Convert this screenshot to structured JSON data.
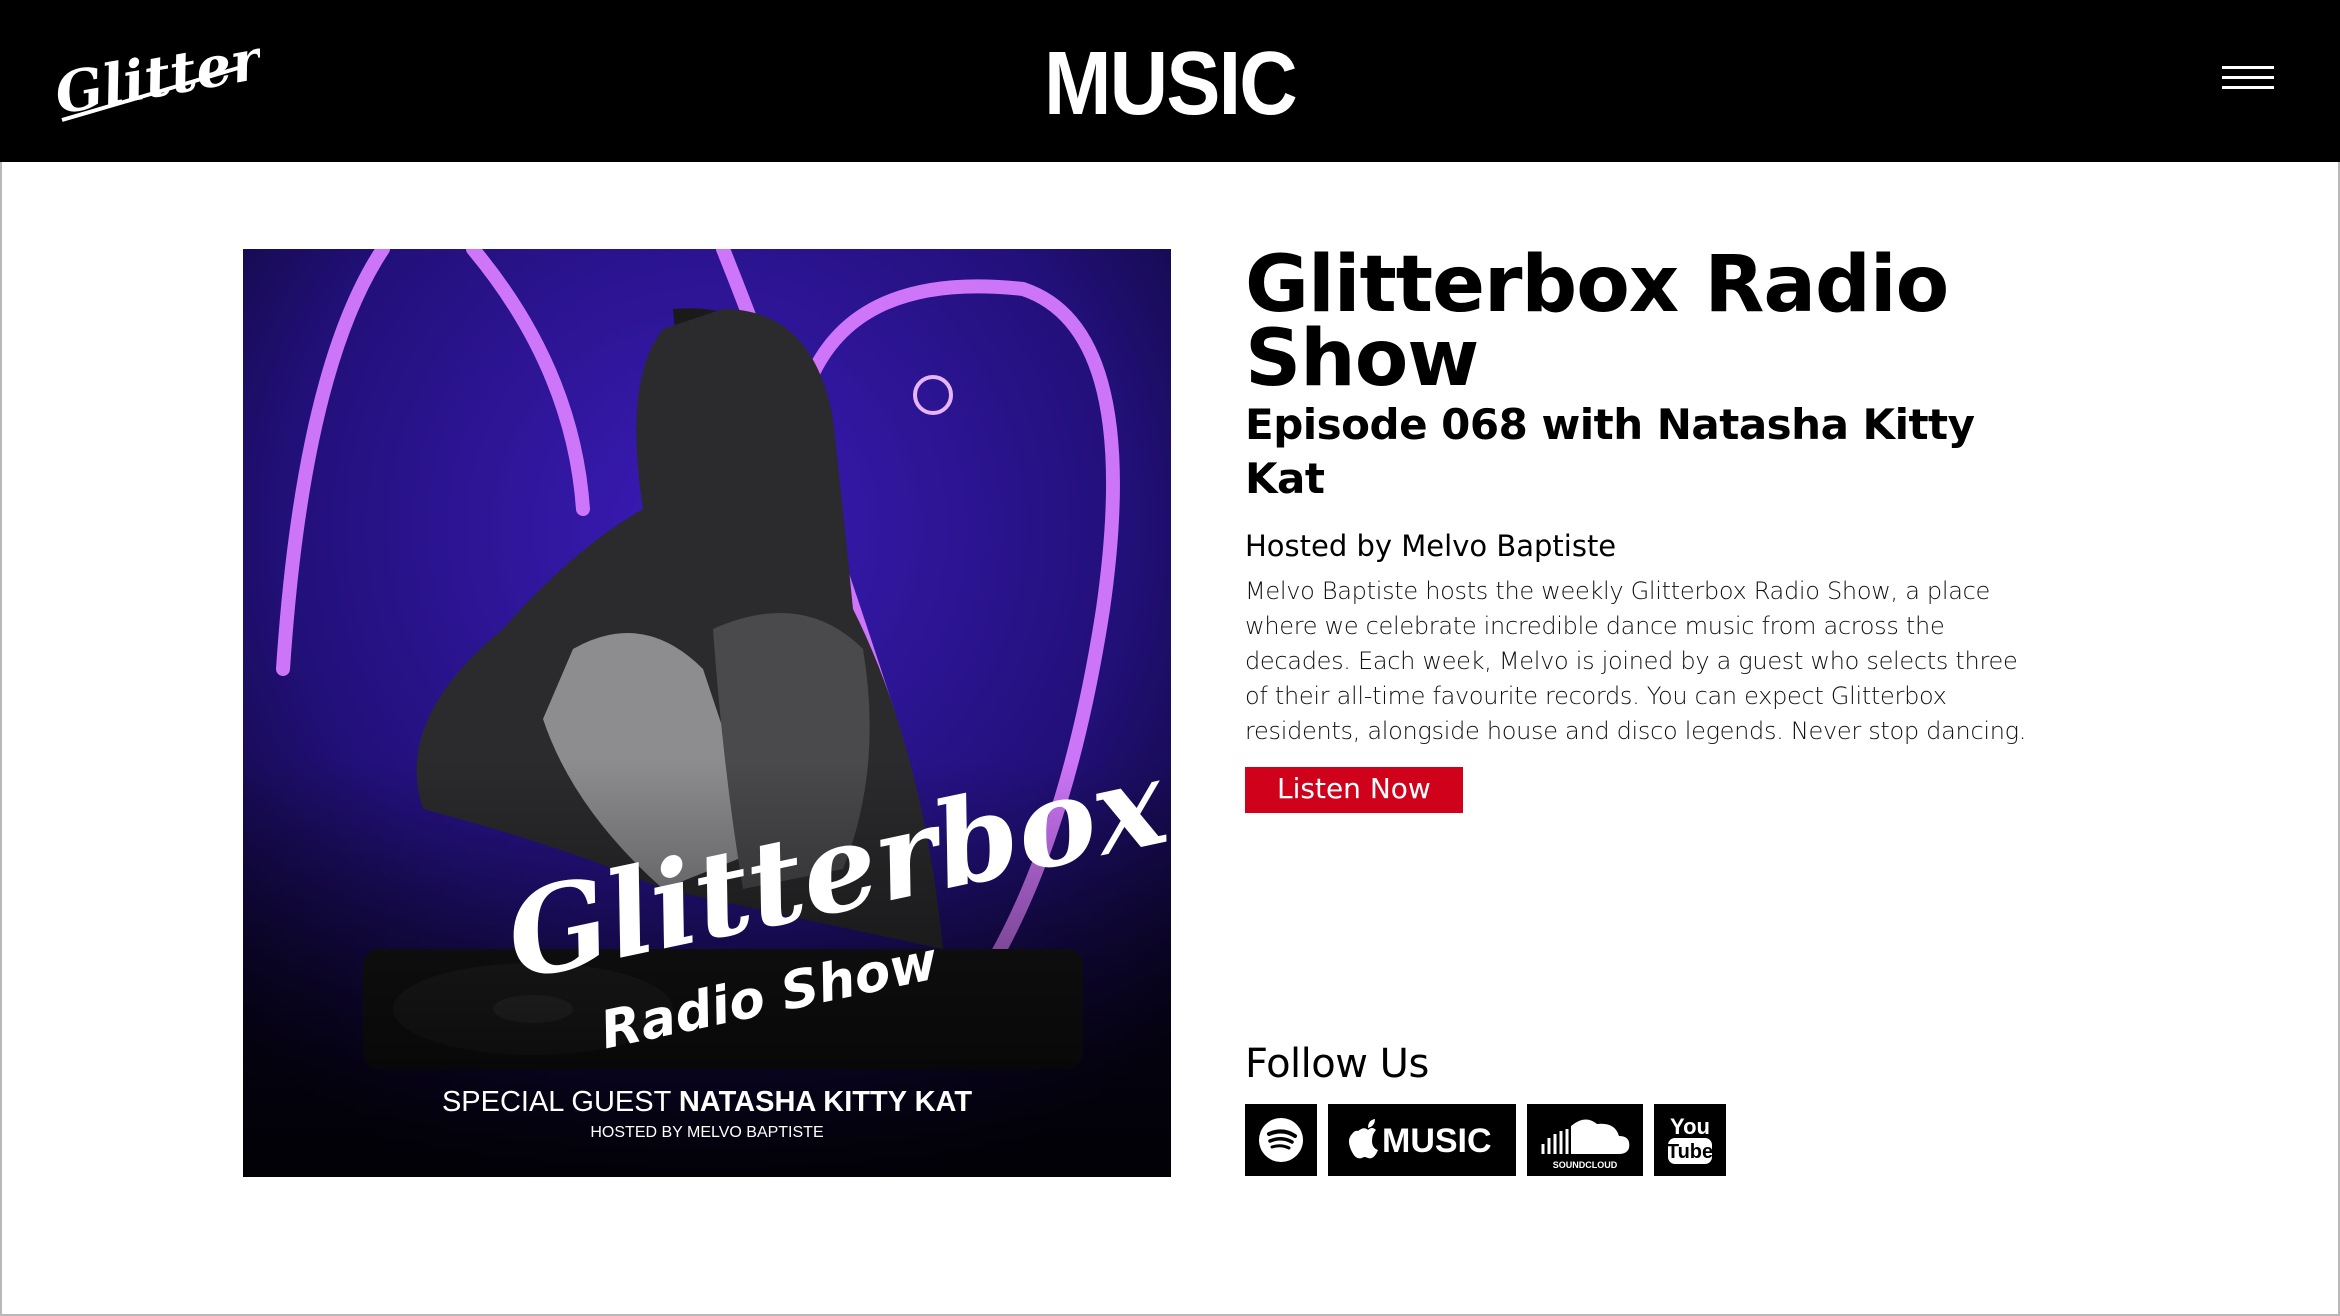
{
  "header": {
    "logo_text": "Glitterbox",
    "title": "MUSIC",
    "menu_icon": "hamburger-icon"
  },
  "artwork": {
    "logo_text": "Glitterbox",
    "show_text": "Radio Show",
    "guest_prefix": "SPECIAL GUEST",
    "guest_name": "NATASHA KITTY KAT",
    "hosted_by": "HOSTED BY MELVO BAPTISTE"
  },
  "show": {
    "title": "Glitterbox Radio Show",
    "episode": "Episode 068 with Natasha Kitty Kat",
    "host": "Hosted by Melvo Baptiste",
    "description": "Melvo Baptiste hosts the weekly Glitterbox Radio Show, a place where we celebrate incredible dance music from across the decades. Each week, Melvo is joined by a guest who selects three of their all-time favourite records. You can expect Glitterbox residents, alongside house and disco legends. Never stop dancing.",
    "listen_label": "Listen Now"
  },
  "follow": {
    "title": "Follow Us",
    "services": [
      {
        "icon": "spotify-icon",
        "label": ""
      },
      {
        "icon": "apple-music-icon",
        "label": "MUSIC"
      },
      {
        "icon": "soundcloud-icon",
        "label": "SOUNDCLOUD"
      },
      {
        "icon": "youtube-icon",
        "label_top": "You",
        "label_bottom": "Tube"
      }
    ]
  },
  "colors": {
    "header_bg": "#000000",
    "accent_red": "#d0021b",
    "artwork_purple": "#2a0f8f",
    "neon_pink": "#d77bff"
  }
}
